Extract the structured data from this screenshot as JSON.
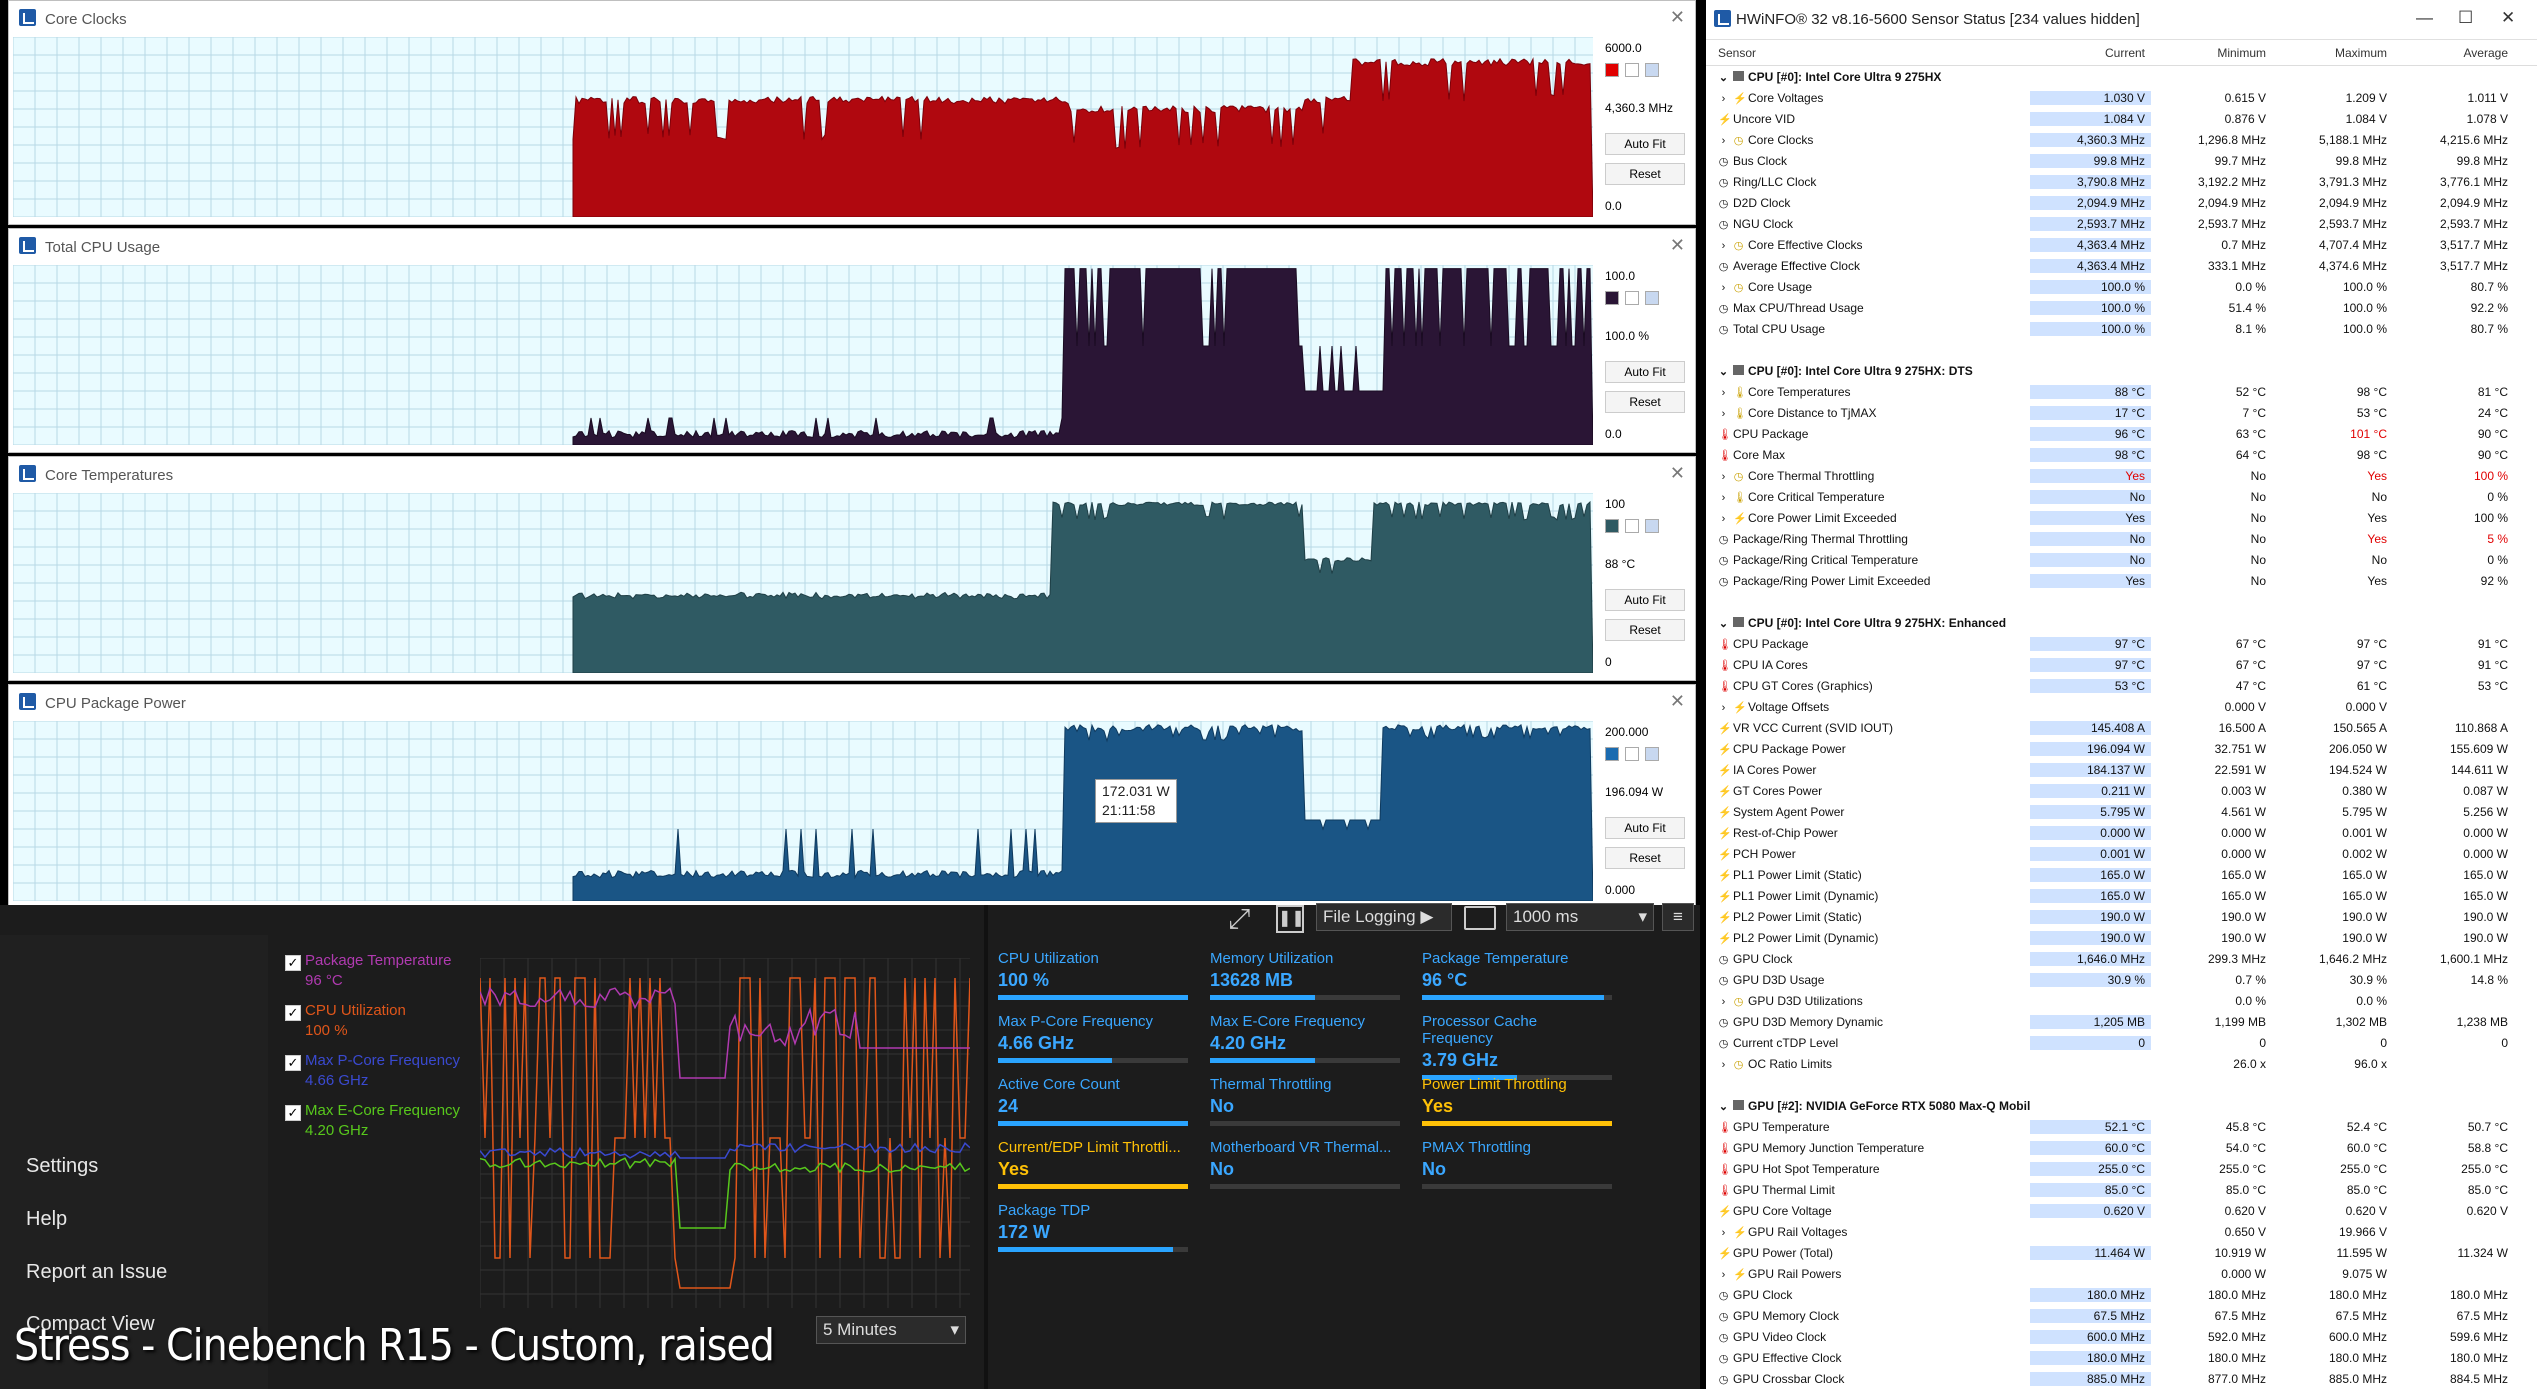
{
  "graphs": [
    {
      "title": "Core Clocks",
      "top": "6000.0",
      "cur": "4,360.3 MHz",
      "bot": "0.0",
      "color": "#b0080f",
      "dark": "#7a0009",
      "sw": "#e00000",
      "base": 0.72,
      "hi1": 0.72,
      "hi2": 0.72,
      "mid": 0.77,
      "high": 0.58
    },
    {
      "title": "Total CPU Usage",
      "top": "100.0",
      "cur": "100.0 %",
      "bot": "0.0",
      "color": "#2a1535",
      "dark": "#1a0b22",
      "sw": "#2a1535"
    },
    {
      "title": "Core Temperatures",
      "top": "100",
      "cur": "88 °C",
      "bot": "0",
      "color": "#2f5a63",
      "dark": "#1f3f46",
      "sw": "#2f5a63"
    },
    {
      "title": "CPU Package Power",
      "top": "200.000",
      "cur": "196.094 W",
      "bot": "0.000",
      "color": "#1a5585",
      "dark": "#0f3a5e",
      "sw": "#1a6bb0",
      "tooltip_value": "172.031 W",
      "tooltip_time": "21:11:58"
    }
  ],
  "buttons": {
    "autofit": "Auto Fit",
    "reset": "Reset"
  },
  "hwinfo": {
    "title": "HWiNFO® 32 v8.16-5600 Sensor Status [234 values hidden]",
    "headers": [
      "Sensor",
      "Current",
      "Minimum",
      "Maximum",
      "Average"
    ],
    "rows": [
      [
        "g",
        "CPU [#0]: Intel Core Ultra 9 275HX",
        "",
        "",
        "",
        ""
      ],
      [
        "e",
        "Core Voltages",
        "1.030 V",
        "0.615 V",
        "1.209 V",
        "1.011 V"
      ],
      [
        "b",
        "Uncore VID",
        "1.084 V",
        "0.876 V",
        "1.084 V",
        "1.078 V"
      ],
      [
        "e",
        "Core Clocks",
        "4,360.3 MHz",
        "1,296.8 MHz",
        "5,188.1 MHz",
        "4,215.6 MHz"
      ],
      [
        "c",
        "Bus Clock",
        "99.8 MHz",
        "99.7 MHz",
        "99.8 MHz",
        "99.8 MHz"
      ],
      [
        "c",
        "Ring/LLC Clock",
        "3,790.8 MHz",
        "3,192.2 MHz",
        "3,791.3 MHz",
        "3,776.1 MHz"
      ],
      [
        "c",
        "D2D Clock",
        "2,094.9 MHz",
        "2,094.9 MHz",
        "2,094.9 MHz",
        "2,094.9 MHz"
      ],
      [
        "c",
        "NGU Clock",
        "2,593.7 MHz",
        "2,593.7 MHz",
        "2,593.7 MHz",
        "2,593.7 MHz"
      ],
      [
        "e",
        "Core Effective Clocks",
        "4,363.4 MHz",
        "0.7 MHz",
        "4,707.4 MHz",
        "3,517.7 MHz"
      ],
      [
        "c",
        "Average Effective Clock",
        "4,363.4 MHz",
        "333.1 MHz",
        "4,374.6 MHz",
        "3,517.7 MHz"
      ],
      [
        "e",
        "Core Usage",
        "100.0 %",
        "0.0 %",
        "100.0 %",
        "80.7 %"
      ],
      [
        "c",
        "Max CPU/Thread Usage",
        "100.0 %",
        "51.4 %",
        "100.0 %",
        "92.2 %"
      ],
      [
        "c",
        "Total CPU Usage",
        "100.0 %",
        "8.1 %",
        "100.0 %",
        "80.7 %"
      ],
      [
        "s",
        "",
        "",
        "",
        "",
        ""
      ],
      [
        "g",
        "CPU [#0]: Intel Core Ultra 9 275HX: DTS",
        "",
        "",
        "",
        ""
      ],
      [
        "e",
        "Core Temperatures",
        "88 °C",
        "52 °C",
        "98 °C",
        "81 °C"
      ],
      [
        "e",
        "Core Distance to TjMAX",
        "17 °C",
        "7 °C",
        "53 °C",
        "24 °C"
      ],
      [
        "t",
        "CPU Package",
        "96 °C",
        "63 °C",
        "101 °C",
        "90 °C"
      ],
      [
        "t",
        "Core Max",
        "98 °C",
        "64 °C",
        "98 °C",
        "90 °C"
      ],
      [
        "e",
        "Core Thermal Throttling",
        "Yes",
        "No",
        "Yes",
        "100 %"
      ],
      [
        "e",
        "Core Critical Temperature",
        "No",
        "No",
        "No",
        "0 %"
      ],
      [
        "e",
        "Core Power Limit Exceeded",
        "Yes",
        "No",
        "Yes",
        "100 %"
      ],
      [
        "c",
        "Package/Ring Thermal Throttling",
        "No",
        "No",
        "Yes",
        "5 %"
      ],
      [
        "c",
        "Package/Ring Critical Temperature",
        "No",
        "No",
        "No",
        "0 %"
      ],
      [
        "c",
        "Package/Ring Power Limit Exceeded",
        "Yes",
        "No",
        "Yes",
        "92 %"
      ],
      [
        "s",
        "",
        "",
        "",
        "",
        ""
      ],
      [
        "g",
        "CPU [#0]: Intel Core Ultra 9 275HX: Enhanced",
        "",
        "",
        "",
        ""
      ],
      [
        "t",
        "CPU Package",
        "97 °C",
        "67 °C",
        "97 °C",
        "91 °C"
      ],
      [
        "t",
        "CPU IA Cores",
        "97 °C",
        "67 °C",
        "97 °C",
        "91 °C"
      ],
      [
        "t",
        "CPU GT Cores (Graphics)",
        "53 °C",
        "47 °C",
        "61 °C",
        "53 °C"
      ],
      [
        "e",
        "Voltage Offsets",
        "",
        "0.000 V",
        "0.000 V",
        ""
      ],
      [
        "b",
        "VR VCC Current (SVID IOUT)",
        "145.408 A",
        "16.500 A",
        "150.565 A",
        "110.868 A"
      ],
      [
        "b",
        "CPU Package Power",
        "196.094 W",
        "32.751 W",
        "206.050 W",
        "155.609 W"
      ],
      [
        "b",
        "IA Cores Power",
        "184.137 W",
        "22.591 W",
        "194.524 W",
        "144.611 W"
      ],
      [
        "b",
        "GT Cores Power",
        "0.211 W",
        "0.003 W",
        "0.380 W",
        "0.087 W"
      ],
      [
        "b",
        "System Agent Power",
        "5.795 W",
        "4.561 W",
        "5.795 W",
        "5.256 W"
      ],
      [
        "b",
        "Rest-of-Chip Power",
        "0.000 W",
        "0.000 W",
        "0.001 W",
        "0.000 W"
      ],
      [
        "b",
        "PCH Power",
        "0.001 W",
        "0.000 W",
        "0.002 W",
        "0.000 W"
      ],
      [
        "b",
        "PL1 Power Limit (Static)",
        "165.0 W",
        "165.0 W",
        "165.0 W",
        "165.0 W"
      ],
      [
        "b",
        "PL1 Power Limit (Dynamic)",
        "165.0 W",
        "165.0 W",
        "165.0 W",
        "165.0 W"
      ],
      [
        "b",
        "PL2 Power Limit (Static)",
        "190.0 W",
        "190.0 W",
        "190.0 W",
        "190.0 W"
      ],
      [
        "b",
        "PL2 Power Limit (Dynamic)",
        "190.0 W",
        "190.0 W",
        "190.0 W",
        "190.0 W"
      ],
      [
        "c",
        "GPU Clock",
        "1,646.0 MHz",
        "299.3 MHz",
        "1,646.2 MHz",
        "1,600.1 MHz"
      ],
      [
        "c",
        "GPU D3D Usage",
        "30.9 %",
        "0.7 %",
        "30.9 %",
        "14.8 %"
      ],
      [
        "e",
        "GPU D3D Utilizations",
        "",
        "0.0 %",
        "0.0 %",
        ""
      ],
      [
        "c",
        "GPU D3D Memory Dynamic",
        "1,205 MB",
        "1,199 MB",
        "1,302 MB",
        "1,238 MB"
      ],
      [
        "c",
        "Current cTDP Level",
        "0",
        "0",
        "0",
        "0"
      ],
      [
        "e",
        "OC Ratio Limits",
        "",
        "26.0 x",
        "96.0 x",
        ""
      ],
      [
        "s",
        "",
        "",
        "",
        "",
        ""
      ],
      [
        "g",
        "GPU [#2]: NVIDIA  GeForce RTX 5080 Max-Q Mobile",
        "",
        "",
        "",
        ""
      ],
      [
        "t",
        "GPU Temperature",
        "52.1 °C",
        "45.8 °C",
        "52.4 °C",
        "50.7 °C"
      ],
      [
        "t",
        "GPU Memory Junction Temperature",
        "60.0 °C",
        "54.0 °C",
        "60.0 °C",
        "58.8 °C"
      ],
      [
        "t",
        "GPU Hot Spot Temperature",
        "255.0 °C",
        "255.0 °C",
        "255.0 °C",
        "255.0 °C"
      ],
      [
        "t",
        "GPU Thermal Limit",
        "85.0 °C",
        "85.0 °C",
        "85.0 °C",
        "85.0 °C"
      ],
      [
        "b",
        "GPU Core Voltage",
        "0.620 V",
        "0.620 V",
        "0.620 V",
        "0.620 V"
      ],
      [
        "e",
        "GPU Rail Voltages",
        "",
        "0.650 V",
        "19.966 V",
        ""
      ],
      [
        "b",
        "GPU Power (Total)",
        "11.464 W",
        "10.919 W",
        "11.595 W",
        "11.324 W"
      ],
      [
        "e",
        "GPU Rail Powers",
        "",
        "0.000 W",
        "9.075 W",
        ""
      ],
      [
        "c",
        "GPU Clock",
        "180.0 MHz",
        "180.0 MHz",
        "180.0 MHz",
        "180.0 MHz"
      ],
      [
        "c",
        "GPU Memory Clock",
        "67.5 MHz",
        "67.5 MHz",
        "67.5 MHz",
        "67.5 MHz"
      ],
      [
        "c",
        "GPU Video Clock",
        "600.0 MHz",
        "592.0 MHz",
        "600.0 MHz",
        "599.6 MHz"
      ],
      [
        "c",
        "GPU Effective Clock",
        "180.0 MHz",
        "180.0 MHz",
        "180.0 MHz",
        "180.0 MHz"
      ],
      [
        "c",
        "GPU Crossbar Clock",
        "885.0 MHz",
        "877.0 MHz",
        "885.0 MHz",
        "884.5 MHz"
      ]
    ]
  },
  "nav": {
    "settings": "Settings",
    "help": "Help",
    "report": "Report an Issue",
    "compact": "Compact View"
  },
  "legend": [
    {
      "label": "Package Temperature",
      "value": "96 °C",
      "color": "#b03ab0"
    },
    {
      "label": "CPU Utilization",
      "value": "100 %",
      "color": "#e0561a"
    },
    {
      "label": "Max P-Core Frequency",
      "value": "4.66 GHz",
      "color": "#3a4ad0"
    },
    {
      "label": "Max E-Core Frequency",
      "value": "4.20 GHz",
      "color": "#58c81c"
    }
  ],
  "toolbar": {
    "file_logging": "File Logging",
    "interval": "1000 ms",
    "range": "5 Minutes"
  },
  "tiles": [
    {
      "t": "CPU Utilization",
      "v": "100 %",
      "p": 1.0,
      "y": false
    },
    {
      "t": "Memory Utilization",
      "v": "13628 MB",
      "p": 0.55,
      "y": false
    },
    {
      "t": "Package Temperature",
      "v": "96 °C",
      "p": 0.96,
      "y": false
    },
    {
      "t": "Max P-Core Frequency",
      "v": "4.66 GHz",
      "p": 0.6,
      "y": false
    },
    {
      "t": "Max E-Core Frequency",
      "v": "4.20 GHz",
      "p": 0.55,
      "y": false
    },
    {
      "t": "Processor Cache Frequency",
      "v": "3.79 GHz",
      "p": 0.5,
      "y": false
    },
    {
      "t": "Active Core Count",
      "v": "24",
      "p": 1.0,
      "y": false
    },
    {
      "t": "Thermal Throttling",
      "v": "No",
      "p": 0,
      "y": false
    },
    {
      "t": "Power Limit Throttling",
      "v": "Yes",
      "p": 1.0,
      "y": true
    },
    {
      "t": "Current/EDP Limit Throttli...",
      "v": "Yes",
      "p": 1.0,
      "y": true
    },
    {
      "t": "Motherboard VR Thermal...",
      "v": "No",
      "p": 0,
      "y": false
    },
    {
      "t": "PMAX Throttling",
      "v": "No",
      "p": 0,
      "y": false
    },
    {
      "t": "Package TDP",
      "v": "172 W",
      "p": 0.92,
      "y": false
    }
  ],
  "caption": "Stress - Cinebench R15 - Custom, raised"
}
